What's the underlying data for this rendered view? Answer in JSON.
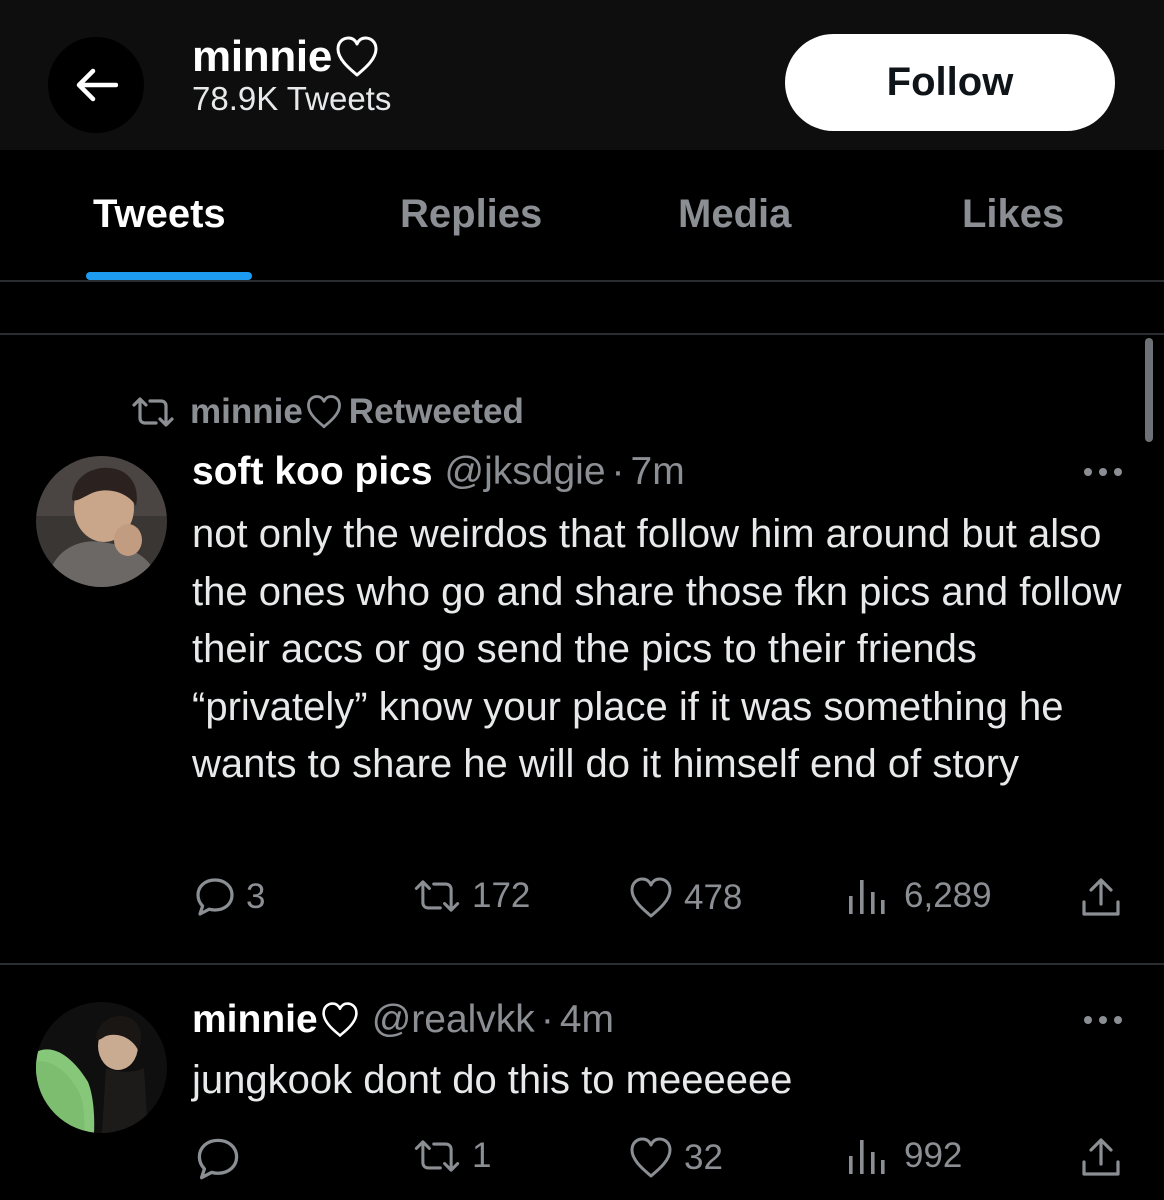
{
  "header": {
    "profile_name": "minnie",
    "tweet_count": "78.9K Tweets",
    "follow_label": "Follow"
  },
  "tabs": [
    {
      "label": "Tweets",
      "active": true
    },
    {
      "label": "Replies",
      "active": false
    },
    {
      "label": "Media",
      "active": false
    },
    {
      "label": "Likes",
      "active": false
    }
  ],
  "tweets": [
    {
      "retweeted_by": "minnie",
      "retweeted_label": "Retweeted",
      "display_name": "soft koo pics",
      "handle": "@jksdgie",
      "separator": "·",
      "time": "7m",
      "text": "not only the weirdos that follow him around but also the ones who go and share those fkn pics and follow their accs or go send the pics to their friends “privately” know your place if it was something he wants to share he will do it himself end of story",
      "replies": "3",
      "retweets": "172",
      "likes": "478",
      "views": "6,289"
    },
    {
      "display_name": "minnie",
      "handle": "@realvkk",
      "separator": "·",
      "time": "4m",
      "text": "jungkook dont do this to meeeeee",
      "replies": "",
      "retweets": "1",
      "likes": "32",
      "views": "992"
    }
  ],
  "colors": {
    "background": "#000000",
    "header_bg": "#0e0e0e",
    "accent_blue": "#1d9bf0",
    "muted_text": "#8b8f94",
    "primary_text": "#e7e9ea"
  },
  "icons": [
    "arrow-left-icon",
    "heart-outline-icon",
    "retweet-icon",
    "more-icon",
    "reply-icon",
    "like-icon",
    "views-icon",
    "share-icon"
  ]
}
